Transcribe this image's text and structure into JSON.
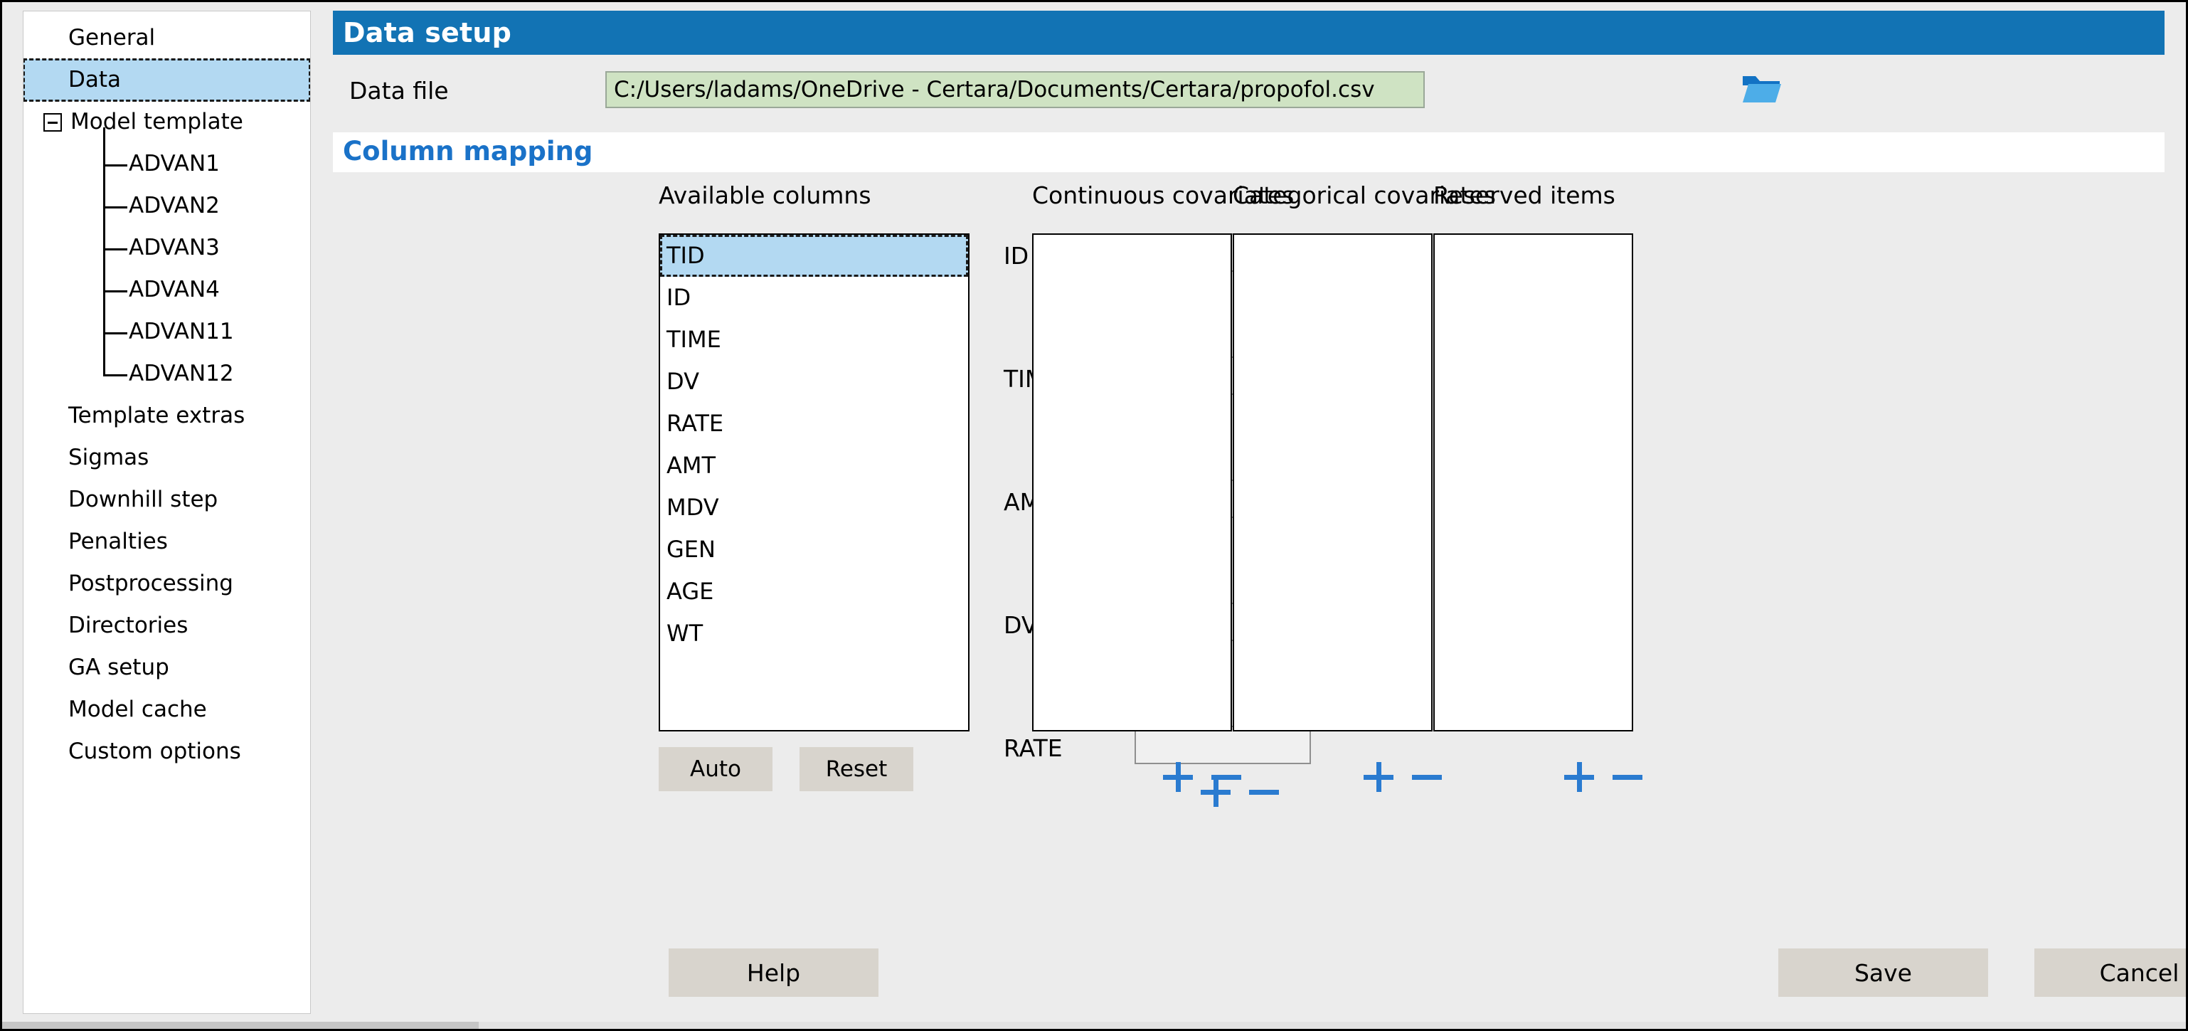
{
  "sidebar": {
    "items": [
      {
        "label": "General",
        "level": 1,
        "selected": false,
        "toggle": false
      },
      {
        "label": "Data",
        "level": 1,
        "selected": true,
        "toggle": false
      },
      {
        "label": "Model template",
        "level": 1,
        "selected": false,
        "toggle": true
      },
      {
        "label": "ADVAN1",
        "level": 2,
        "selected": false,
        "toggle": false
      },
      {
        "label": "ADVAN2",
        "level": 2,
        "selected": false,
        "toggle": false
      },
      {
        "label": "ADVAN3",
        "level": 2,
        "selected": false,
        "toggle": false
      },
      {
        "label": "ADVAN4",
        "level": 2,
        "selected": false,
        "toggle": false
      },
      {
        "label": "ADVAN11",
        "level": 2,
        "selected": false,
        "toggle": false
      },
      {
        "label": "ADVAN12",
        "level": 2,
        "selected": false,
        "toggle": false
      },
      {
        "label": "Template extras",
        "level": 1,
        "selected": false,
        "toggle": false
      },
      {
        "label": "Sigmas",
        "level": 1,
        "selected": false,
        "toggle": false
      },
      {
        "label": "Downhill step",
        "level": 1,
        "selected": false,
        "toggle": false
      },
      {
        "label": "Penalties",
        "level": 1,
        "selected": false,
        "toggle": false
      },
      {
        "label": "Postprocessing",
        "level": 1,
        "selected": false,
        "toggle": false
      },
      {
        "label": "Directories",
        "level": 1,
        "selected": false,
        "toggle": false
      },
      {
        "label": "GA setup",
        "level": 1,
        "selected": false,
        "toggle": false
      },
      {
        "label": "Model cache",
        "level": 1,
        "selected": false,
        "toggle": false
      },
      {
        "label": "Custom options",
        "level": 1,
        "selected": false,
        "toggle": false
      }
    ]
  },
  "header": {
    "title": "Data setup",
    "accent_color": "#1273b4"
  },
  "datafile": {
    "label": "Data file",
    "value": "C:/Users/ladams/OneDrive - Certara/Documents/Certara/propofol.csv",
    "placeholder": "",
    "browse_icon": "folder-open-icon",
    "field_bg": "#cfe3c3"
  },
  "column_mapping": {
    "title": "Column mapping",
    "title_color": "#1a72c8",
    "available_columns": {
      "label": "Available columns",
      "items": [
        "TID",
        "ID",
        "TIME",
        "DV",
        "RATE",
        "AMT",
        "MDV",
        "GEN",
        "AGE",
        "WT"
      ],
      "selected": "TID"
    },
    "buttons": {
      "auto": "Auto",
      "reset": "Reset"
    },
    "mappings": [
      {
        "label": "ID",
        "value": ""
      },
      {
        "label": "TIME",
        "value": ""
      },
      {
        "label": "AMT",
        "value": ""
      },
      {
        "label": "DV",
        "value": ""
      },
      {
        "label": "RATE",
        "value": ""
      }
    ],
    "panels": [
      {
        "label": "Continuous covariates",
        "items": []
      },
      {
        "label": "Categorical covariates",
        "items": []
      },
      {
        "label": "Reserved items",
        "items": []
      }
    ],
    "add_icon": "plus-icon",
    "remove_icon": "minus-icon",
    "icon_color": "#2a7bd0"
  },
  "footer": {
    "help": "Help",
    "save": "Save",
    "cancel": "Cancel"
  }
}
